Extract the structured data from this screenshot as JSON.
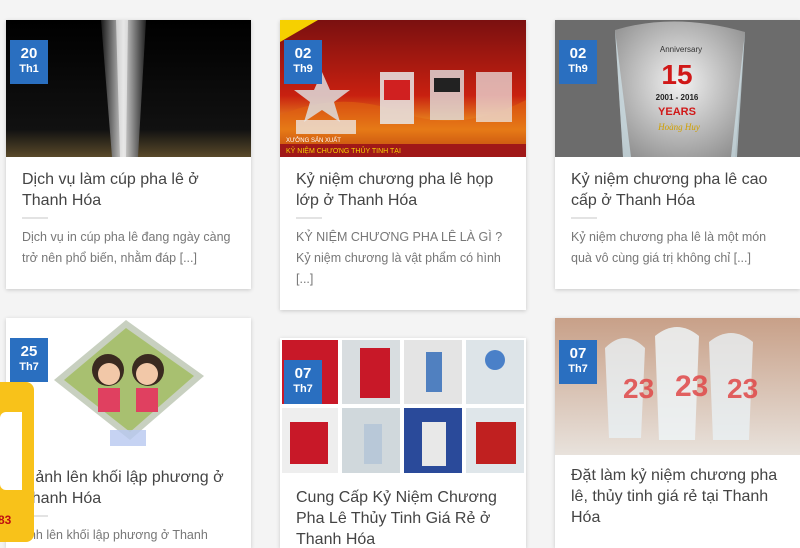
{
  "posts": [
    {
      "day": "20",
      "month": "Th1",
      "title": "Dịch vụ làm cúp pha lê ở Thanh Hóa",
      "excerpt": "Dịch vụ in cúp pha lê đang ngày càng trở nên phổ biến, nhằm đáp [...]"
    },
    {
      "day": "02",
      "month": "Th9",
      "title": "Kỷ niệm chương pha lê họp lớp ở Thanh Hóa",
      "excerpt": "KỶ NIỆM CHƯƠNG PHA LÊ LÀ GÌ ? Kỷ niệm chương là vật phẩm có hình [...]",
      "banner_line1": "XƯỞNG SẢN XUẤT",
      "banner_line2": "KỶ NIỆM CHƯƠNG THỦY TINH TẠI"
    },
    {
      "day": "02",
      "month": "Th9",
      "title": "Kỷ niệm chương pha lê cao cấp ở Thanh Hóa",
      "excerpt": "Kỷ niệm chương pha lê là một món quà vô cùng giá trị không chỉ [...]",
      "anniv_label": "Anniversary",
      "anniv_number": "15",
      "anniv_years": "2001 - 2016",
      "anniv_word": "YEARS",
      "anniv_brand": "Hoàng Huy"
    },
    {
      "day": "25",
      "month": "Th7",
      "title": "n ảnh lên khối lập phương ở Thanh Hóa",
      "excerpt": "ảnh lên khối lập phương ở Thanh"
    },
    {
      "day": "07",
      "month": "Th7",
      "title": "Cung Cấp Kỷ Niệm Chương Pha Lê Thủy Tinh Giá Rẻ ở Thanh Hóa",
      "excerpt": ""
    },
    {
      "day": "07",
      "month": "Th7",
      "title": "Đặt làm kỷ niệm chương pha lê, thủy tinh giá rẻ tại Thanh Hóa",
      "excerpt": ""
    }
  ],
  "widget": {
    "number": "83"
  },
  "colors": {
    "badge": "#2a6fc0",
    "widget": "#f8c21a",
    "title": "#444444",
    "excerpt": "#777777"
  }
}
